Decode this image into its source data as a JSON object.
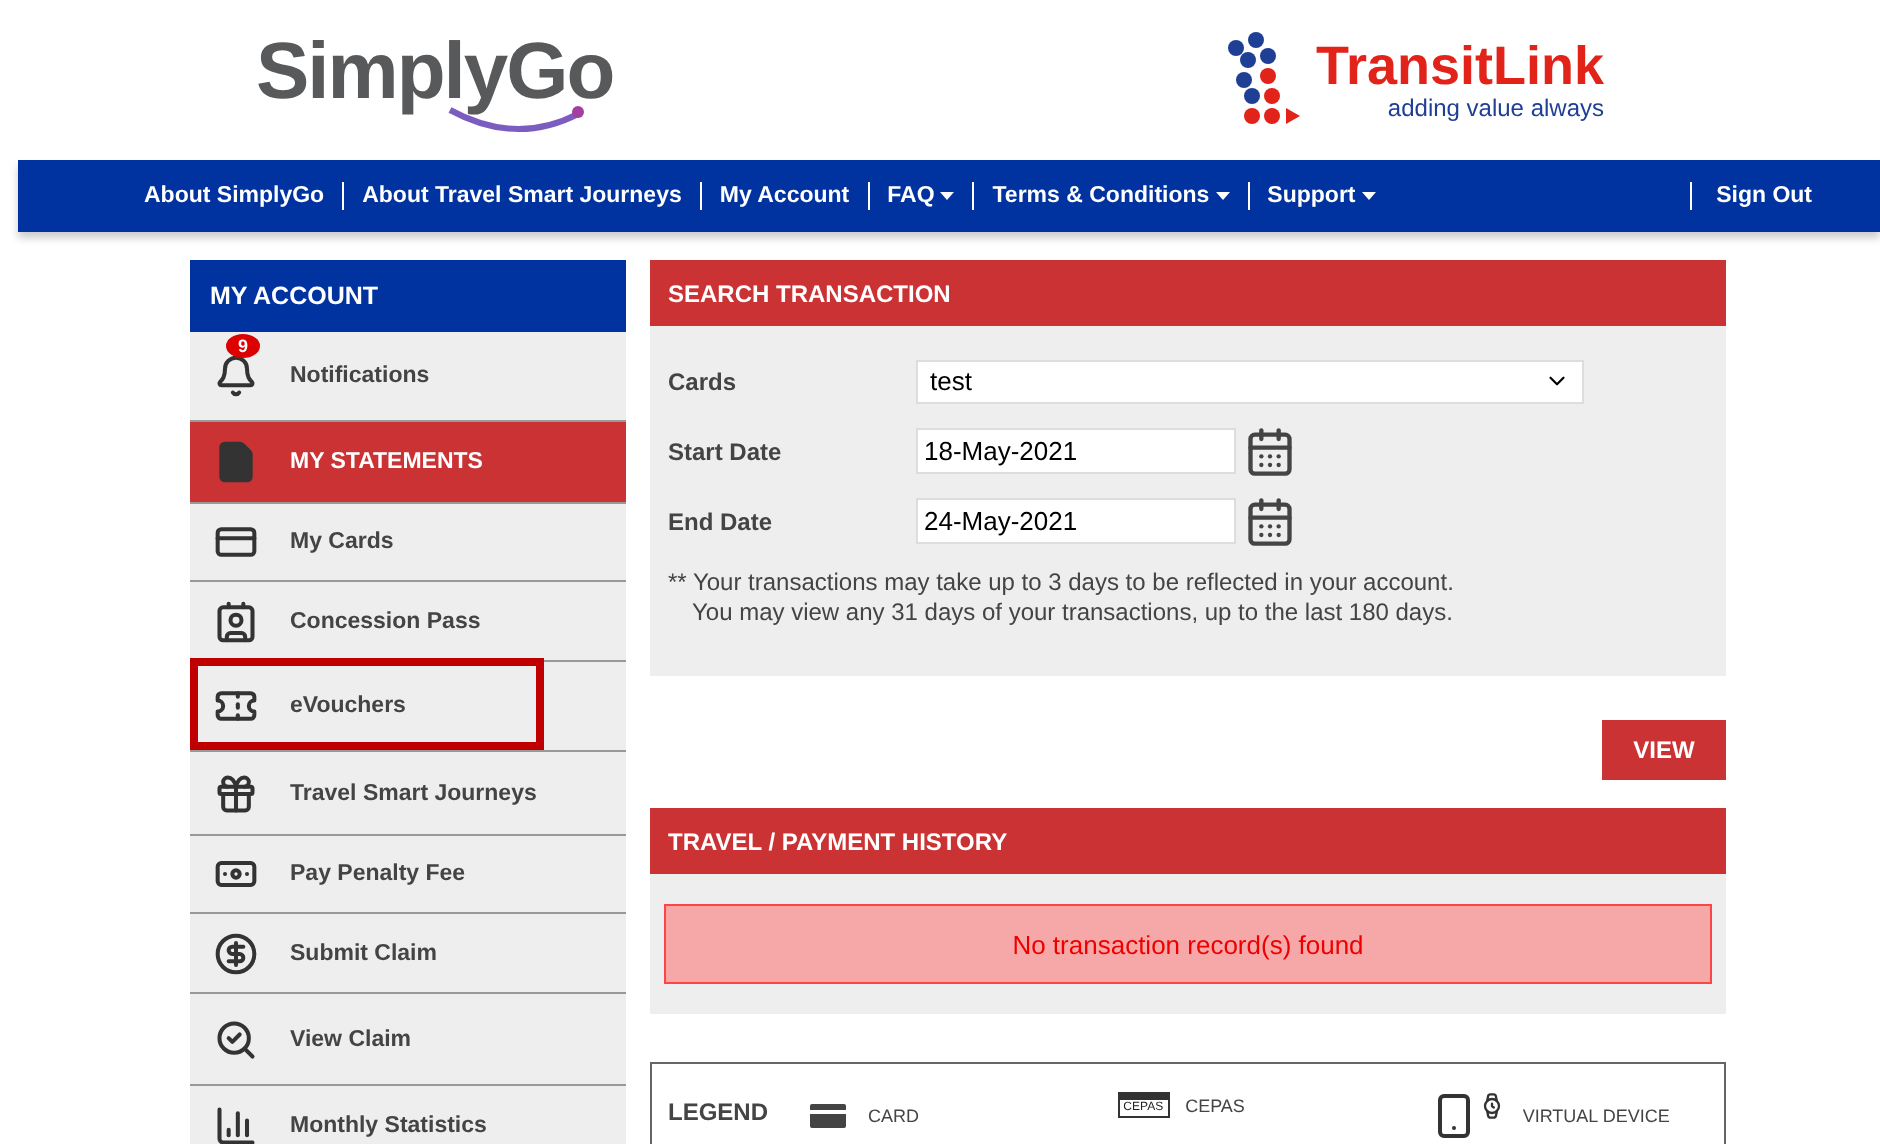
{
  "header": {
    "simplygo_logo": "SimplyGo",
    "transitlink_logo": "TransitLink",
    "transitlink_tagline": "adding value always"
  },
  "nav": {
    "links": [
      {
        "label": "About SimplyGo",
        "dropdown": false
      },
      {
        "label": "About Travel Smart Journeys",
        "dropdown": false
      },
      {
        "label": "My Account",
        "dropdown": false
      },
      {
        "label": "FAQ",
        "dropdown": true
      },
      {
        "label": "Terms & Conditions",
        "dropdown": true
      },
      {
        "label": "Support",
        "dropdown": true
      }
    ],
    "sign_out": "Sign Out"
  },
  "sidebar": {
    "title": "MY ACCOUNT",
    "items": [
      {
        "label": "Notifications",
        "badge": "9",
        "selected": false,
        "highlighted": false
      },
      {
        "label": "MY STATEMENTS",
        "selected": true,
        "highlighted": false
      },
      {
        "label": "My Cards",
        "selected": false,
        "highlighted": false
      },
      {
        "label": "Concession Pass",
        "selected": false,
        "highlighted": false
      },
      {
        "label": "eVouchers",
        "selected": false,
        "highlighted": true
      },
      {
        "label": "Travel Smart Journeys",
        "selected": false,
        "highlighted": false
      },
      {
        "label": "Pay Penalty Fee",
        "selected": false,
        "highlighted": false
      },
      {
        "label": "Submit Claim",
        "selected": false,
        "highlighted": false
      },
      {
        "label": "View Claim",
        "selected": false,
        "highlighted": false
      },
      {
        "label": "Monthly Statistics",
        "selected": false,
        "highlighted": false
      }
    ]
  },
  "search": {
    "title": "SEARCH TRANSACTION",
    "cards_label": "Cards",
    "cards_value": "test",
    "start_label": "Start Date",
    "start_value": "18-May-2021",
    "end_label": "End Date",
    "end_value": "24-May-2021",
    "note_1": "** Your transactions may take up to 3 days to be reflected in your account.",
    "note_2": "You may view any 31 days of your transactions, up to the last 180 days.",
    "view_button": "VIEW"
  },
  "history": {
    "title": "TRAVEL / PAYMENT HISTORY",
    "message": "No transaction record(s) found"
  },
  "legend": {
    "title": "LEGEND",
    "items": [
      {
        "kind": "card",
        "label": "CARD"
      },
      {
        "kind": "cepas",
        "label": "CEPAS",
        "icon_text": "CEPAS"
      },
      {
        "kind": "device",
        "label": "VIRTUAL DEVICE"
      }
    ]
  }
}
